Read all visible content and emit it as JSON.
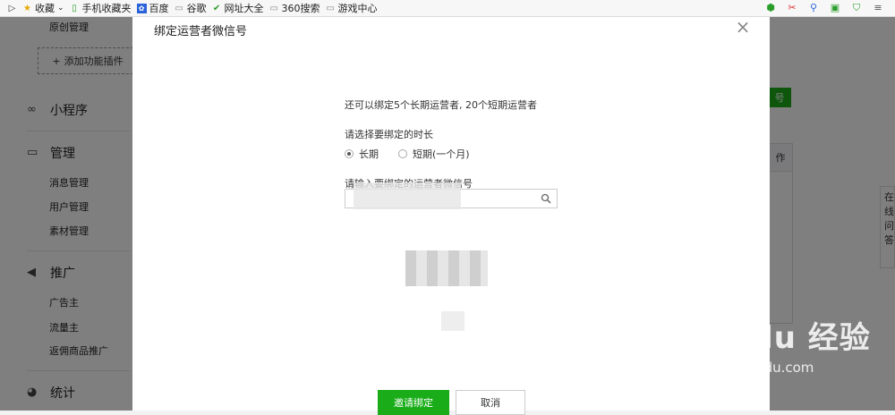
{
  "bookmarks": {
    "items": [
      {
        "label": "收藏",
        "icon": "star-icon"
      },
      {
        "label": "手机收藏夹",
        "icon": "phone-icon"
      },
      {
        "label": "百度",
        "icon": "paw-icon"
      },
      {
        "label": "谷歌",
        "icon": "page-icon"
      },
      {
        "label": "网址大全",
        "icon": "check-icon"
      },
      {
        "label": "360搜索",
        "icon": "page-icon"
      },
      {
        "label": "游戏中心",
        "icon": "page-icon"
      }
    ]
  },
  "sidebar": {
    "top_item": "原创管理",
    "add_plugin": "添加功能插件",
    "sections": [
      {
        "label": "小程序",
        "icon": "link-icon"
      },
      {
        "label": "管理",
        "icon": "inbox-icon",
        "items": [
          "消息管理",
          "用户管理",
          "素材管理"
        ]
      },
      {
        "label": "推广",
        "icon": "megaphone-icon",
        "items": [
          "广告主",
          "流量主",
          "返佣商品推广"
        ]
      },
      {
        "label": "统计",
        "icon": "pie-icon"
      }
    ]
  },
  "background": {
    "green_btn": "号",
    "table_header": "作",
    "tip_text": "在线问答"
  },
  "dialog": {
    "title": "绑定运营者微信号",
    "tip": "还可以绑定5个长期运营者, 20个短期运营者",
    "duration_label": "请选择要绑定的时长",
    "options": [
      {
        "label": "长期",
        "checked": true
      },
      {
        "label": "短期(一个月)",
        "checked": false
      }
    ],
    "input_label": "请输入要绑定的运营者微信号",
    "input_placeholder": "",
    "confirm": "邀请绑定",
    "cancel": "取消"
  },
  "watermark": {
    "main": "Bai du 经验",
    "sub": "jingyan.baidu.com"
  }
}
